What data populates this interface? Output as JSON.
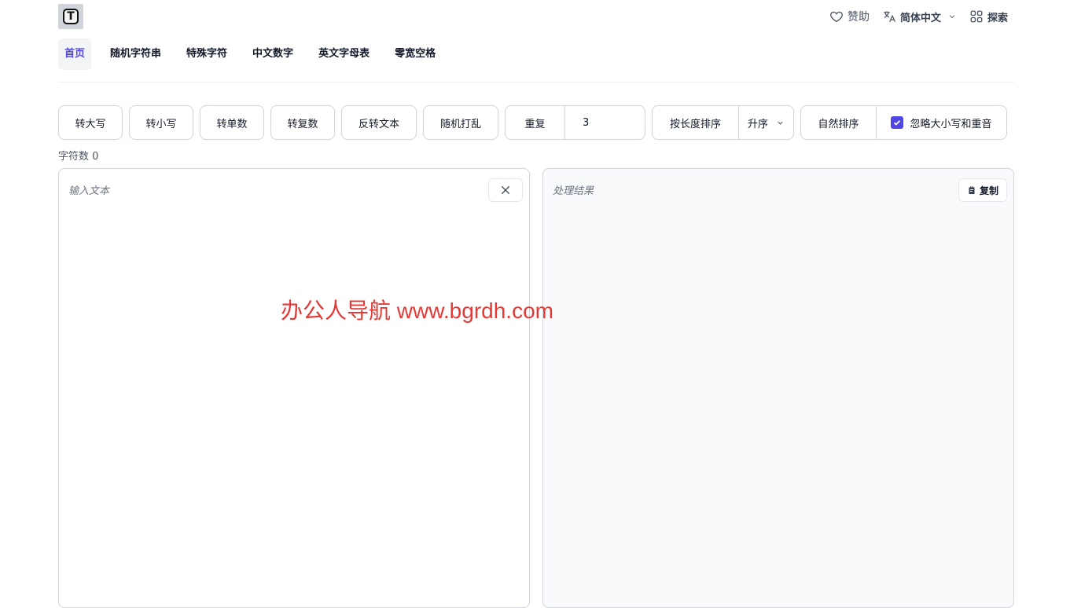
{
  "logo": {
    "letter": "T"
  },
  "header": {
    "sponsor_label": "赞助",
    "language_label": "简体中文",
    "explore_label": "探索"
  },
  "nav": {
    "items": [
      "首页",
      "随机字符串",
      "特殊字符",
      "中文数字",
      "英文字母表",
      "零宽空格"
    ],
    "active": "首页"
  },
  "toolbar": {
    "uppercase": "转大写",
    "lowercase": "转小写",
    "singular": "转单数",
    "plural": "转复数",
    "reverse": "反转文本",
    "shuffle": "随机打乱",
    "repeat_label": "重复",
    "repeat_value": "3",
    "sort_by_length": "按长度排序",
    "sort_order": "升序",
    "natural_sort": "自然排序",
    "ignore_case_label": "忽略大小写和重音",
    "ignore_case_checked": true
  },
  "stats": {
    "char_count": "字符数 0"
  },
  "input_panel": {
    "placeholder": "输入文本"
  },
  "output_panel": {
    "placeholder": "处理结果",
    "copy_label": "复制"
  },
  "watermark": {
    "text": "办公人导航  www.bgrdh.com"
  },
  "colors": {
    "accent": "#4f46e5",
    "watermark": "#e53935",
    "border": "#d1d5db"
  }
}
